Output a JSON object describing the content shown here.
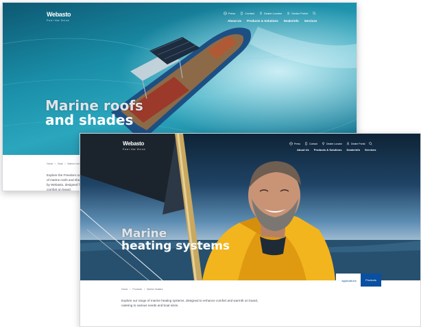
{
  "back_page": {
    "logo": "Webasto",
    "logo_tagline": "Feel the Drive",
    "utility_nav": [
      {
        "icon": "globe-icon",
        "label": "Press"
      },
      {
        "icon": "phone-icon",
        "label": "Contact"
      },
      {
        "icon": "pin-icon",
        "label": "Dealer Locator"
      },
      {
        "icon": "user-icon",
        "label": "Dealer Portal"
      },
      {
        "icon": "search-icon",
        "label": "Search"
      }
    ],
    "main_nav": [
      "About Us",
      "Products & Solutions",
      "Dealerinfo",
      "Services"
    ],
    "hero_title_line1": "Marine roofs",
    "hero_title_line2": "and shades",
    "breadcrumb": [
      "Home",
      "Boat",
      "Marine roofs"
    ],
    "description": "Explore the Freedom range of marine roofs and shades by Webasto, designed for comfort on board."
  },
  "front_page": {
    "logo": "Webasto",
    "logo_tagline": "Feel the Drive",
    "utility_nav": [
      {
        "icon": "globe-icon",
        "label": "Press"
      },
      {
        "icon": "phone-icon",
        "label": "Contact"
      },
      {
        "icon": "pin-icon",
        "label": "Dealer Locator"
      },
      {
        "icon": "user-icon",
        "label": "Dealer Portal"
      },
      {
        "icon": "search-icon",
        "label": "Search"
      }
    ],
    "main_nav": [
      "About Us",
      "Products & Solutions",
      "Dealerinfo",
      "Services"
    ],
    "hero_title_line1": "Marine",
    "hero_title_line2": "heating systems",
    "breadcrumb": [
      "Home",
      "Products",
      "Marine heaters"
    ],
    "description_line1": "Explore our range of marine heating systems, designed to enhance comfort and warmth on board,",
    "description_line2": "catering to various needs and boat sizes.",
    "buttons": {
      "secondary": "Applications",
      "primary": "Products"
    }
  },
  "colors": {
    "brand_blue": "#0a4fa0",
    "text_gray": "#444b55",
    "sea_blue": "#1a8ea8",
    "jacket_yellow": "#f3b51d"
  }
}
